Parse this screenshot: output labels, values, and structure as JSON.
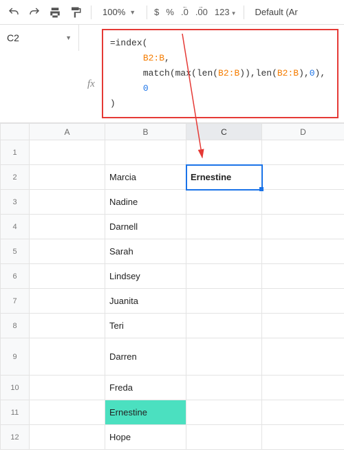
{
  "toolbar": {
    "zoom": "100%",
    "fmt_currency": "$",
    "fmt_percent": "%",
    "fmt_dec_dec": ".0",
    "fmt_dec_inc": ".00",
    "fmt_more": "123",
    "font": "Default (Ar"
  },
  "namebox": {
    "cell_ref": "C2"
  },
  "formula": {
    "line1_a": "=index(",
    "line2_ref": "B2:B",
    "line2_tail": ",",
    "line3_a": "match(max(len(",
    "line3_ref1": "B2:B",
    "line3_b": ")),len(",
    "line3_ref2": "B2:B",
    "line3_c": "),",
    "line3_num": "0",
    "line3_d": "),",
    "line4_num": "0",
    "line5": ")"
  },
  "grid": {
    "headers": [
      "",
      "A",
      "B",
      "C",
      "D"
    ],
    "rows": [
      {
        "n": "1",
        "a": "",
        "b": "",
        "c": "",
        "d": ""
      },
      {
        "n": "2",
        "a": "",
        "b": "Marcia",
        "c": "Ernestine",
        "d": ""
      },
      {
        "n": "3",
        "a": "",
        "b": "Nadine",
        "c": "",
        "d": ""
      },
      {
        "n": "4",
        "a": "",
        "b": "Darnell",
        "c": "",
        "d": ""
      },
      {
        "n": "5",
        "a": "",
        "b": "Sarah",
        "c": "",
        "d": ""
      },
      {
        "n": "6",
        "a": "",
        "b": "Lindsey",
        "c": "",
        "d": ""
      },
      {
        "n": "7",
        "a": "",
        "b": "Juanita",
        "c": "",
        "d": ""
      },
      {
        "n": "8",
        "a": "",
        "b": "Teri",
        "c": "",
        "d": ""
      },
      {
        "n": "9",
        "a": "",
        "b": "Darren",
        "c": "",
        "d": ""
      },
      {
        "n": "10",
        "a": "",
        "b": "Freda",
        "c": "",
        "d": ""
      },
      {
        "n": "11",
        "a": "",
        "b": "Ernestine",
        "c": "",
        "d": ""
      },
      {
        "n": "12",
        "a": "",
        "b": "Hope",
        "c": "",
        "d": ""
      }
    ],
    "selected_cell": "C2",
    "highlighted_cell": "B11"
  }
}
